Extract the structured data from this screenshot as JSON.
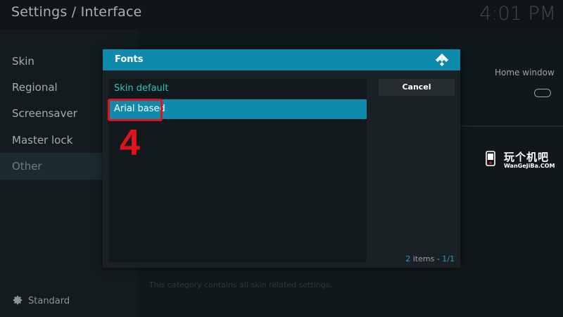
{
  "header": {
    "title": "Settings / Interface",
    "clock": "4:01 PM"
  },
  "sidebar": {
    "items": [
      {
        "label": "Skin"
      },
      {
        "label": "Regional"
      },
      {
        "label": "Screensaver"
      },
      {
        "label": "Master lock"
      },
      {
        "label": "Other"
      }
    ],
    "active_index": 4,
    "level_label": "Standard",
    "level_icon": "gear-icon"
  },
  "settings_panel": {
    "home_window_label": "Home window",
    "home_window_toggle": "off",
    "description": "This category contains all skin related settings."
  },
  "dialog": {
    "title": "Fonts",
    "logo_icon": "kodi-logo-icon",
    "options": [
      {
        "label": "Skin default",
        "selected": false
      },
      {
        "label": "Arial based",
        "selected": true
      }
    ],
    "cancel_label": "Cancel",
    "count_num": "2",
    "count_word": " items - ",
    "page": "1/1"
  },
  "annotation": {
    "step": "4",
    "color": "#e0121a"
  },
  "watermark": {
    "cn": "玩个机吧",
    "en": "WanGeJiBa.COM"
  },
  "colors": {
    "accent": "#0f8aad",
    "teal_text": "#2fc4b8",
    "count_blue": "#1d9fc4"
  }
}
